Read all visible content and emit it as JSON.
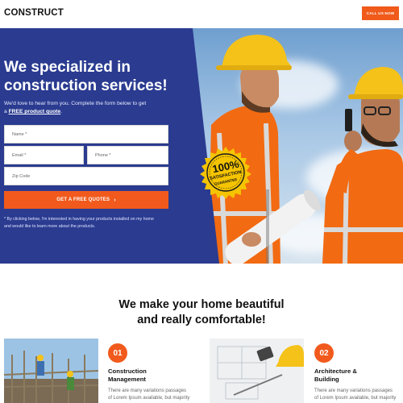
{
  "header": {
    "brand": "CONSTRUCT",
    "call_label": "CALL US NOW"
  },
  "hero": {
    "headline_line1": "We specialized in",
    "headline_line2": "construction services!",
    "sub_line1": "We'd love to hear from you. Complete the form below to get",
    "sub_prefix": "a ",
    "sub_bold": "FREE product quote",
    "sub_suffix": ".",
    "form": {
      "name_placeholder": "Name *",
      "email_placeholder": "Email *",
      "phone_placeholder": "Phone *",
      "zip_placeholder": "Zip Code",
      "submit_label": "GET A FREE QUOTES",
      "submit_icon": "chevron-right-icon"
    },
    "disclaimer_line1": "* By clicking below, I'm interested in having your products installed on my home",
    "disclaimer_line2": "and would like to learn more about the products.",
    "seal": {
      "big": "100%",
      "line1": "SATISFACTION",
      "line2": "GUARANTEE"
    }
  },
  "section": {
    "title_line1": "We make your home beautiful",
    "title_line2": "and really comfortable!",
    "cards": [
      {
        "number": "01",
        "title_line1": "Construction",
        "title_line2": "Management",
        "text_line1": "There are many variations  passages",
        "text_line2": "of Lorem Ipsum available, but majority"
      },
      {
        "number": "02",
        "title_line1": "Architecture &",
        "title_line2": "Building",
        "text_line1": "There are many variations  passages",
        "text_line2": "of Lorem Ipsum available, but majority"
      }
    ]
  },
  "colors": {
    "accent": "#f15a1c",
    "hero_blue": "#2a3b90",
    "helmet_yellow": "#f5c21a",
    "vest_orange": "#f26a12"
  }
}
